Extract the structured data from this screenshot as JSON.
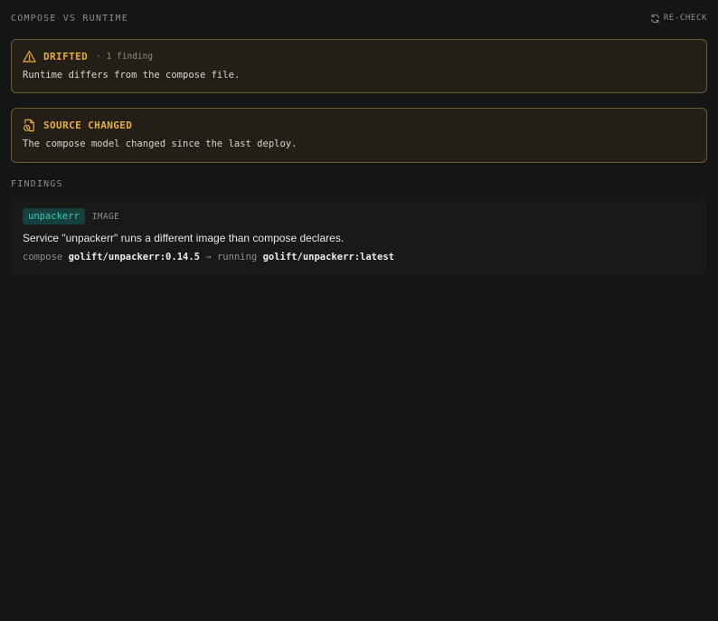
{
  "header": {
    "title": "COMPOSE VS RUNTIME",
    "recheck_label": "RE-CHECK"
  },
  "alerts": {
    "drifted": {
      "title": "DRIFTED",
      "count_text": "· 1 finding",
      "message": "Runtime differs from the compose file.",
      "icon": "warning-triangle-icon"
    },
    "source_changed": {
      "title": "SOURCE CHANGED",
      "message": "The compose model changed since the last deploy.",
      "icon": "file-changed-icon"
    }
  },
  "findings": {
    "label": "FINDINGS",
    "items": [
      {
        "service": "unpackerr",
        "kind": "IMAGE",
        "description": "Service \"unpackerr\" runs a different image than compose declares.",
        "compose_label": "compose",
        "compose_value": "golift/unpackerr:0.14.5",
        "arrow": "→",
        "running_label": "running",
        "running_value": "golift/unpackerr:latest"
      }
    ]
  },
  "colors": {
    "background": "#141515",
    "accent_amber": "#e8ad36",
    "alert_border": "#6c5a30",
    "teal_tag": "#3fc7bb"
  }
}
